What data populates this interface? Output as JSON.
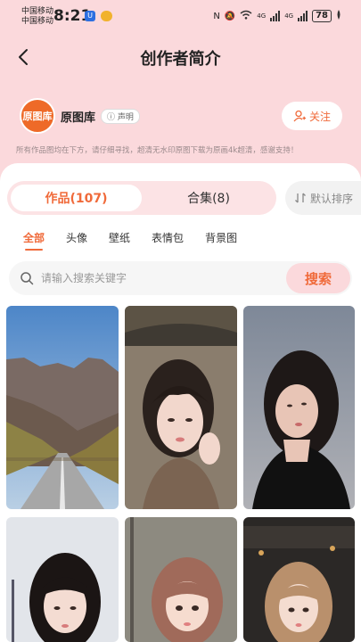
{
  "status_bar": {
    "carrier_1": "中国移动",
    "carrier_2": "中国移动",
    "time": "8:21",
    "network_1": "4G",
    "network_2": "4G",
    "battery": "78"
  },
  "nav": {
    "title": "创作者简介"
  },
  "author": {
    "avatar_text": "原图库",
    "name": "原图库",
    "declare_label": "声明",
    "follow_label": "关注",
    "notice": "所有作品图均在下方，请仔细寻找，超清无水印原图下载为原画4k超清，感谢支持！"
  },
  "tabs": {
    "works_label": "作品(107)",
    "collections_label": "合集(8)",
    "sort_label": "默认排序"
  },
  "categories": [
    "全部",
    "头像",
    "壁纸",
    "表情包",
    "背景图"
  ],
  "search": {
    "placeholder": "请输入搜索关键字",
    "button_label": "搜索"
  },
  "colors": {
    "accent": "#f06a3a",
    "header_bg": "#fbd9dc",
    "segment_bg": "#fce3e5"
  }
}
